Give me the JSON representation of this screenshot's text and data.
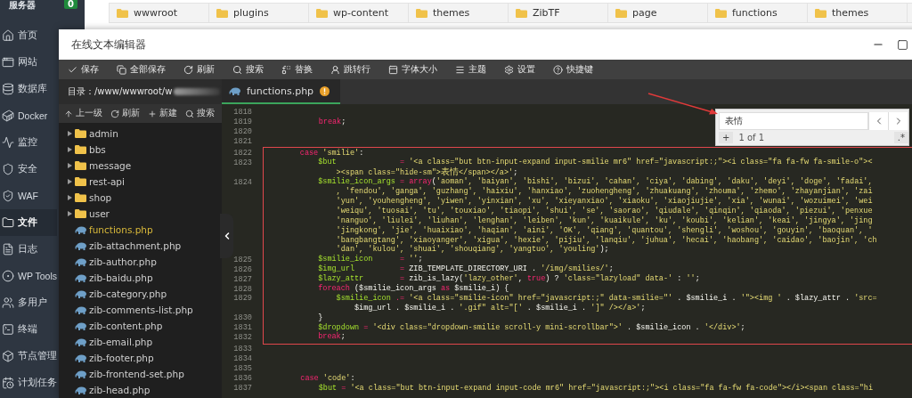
{
  "sidebar": {
    "header": {
      "label": "服务器",
      "badge": "0"
    },
    "items": [
      {
        "label": "首页",
        "selected": false
      },
      {
        "label": "网站",
        "selected": false
      },
      {
        "label": "数据库",
        "selected": false
      },
      {
        "label": "Docker",
        "selected": false
      },
      {
        "label": "监控",
        "selected": false
      },
      {
        "label": "安全",
        "selected": false
      },
      {
        "label": "WAF",
        "selected": false
      },
      {
        "label": "文件",
        "selected": true
      },
      {
        "label": "日志",
        "selected": false
      },
      {
        "label": "WP Tools",
        "selected": false
      },
      {
        "label": "多用户",
        "selected": false
      },
      {
        "label": "终端",
        "selected": false
      },
      {
        "label": "节点管理",
        "selected": false
      },
      {
        "label": "计划任务",
        "selected": false
      }
    ]
  },
  "breadcrumb": [
    "wwwroot",
    "plugins",
    "wp-content",
    "themes",
    "ZibTF",
    "page",
    "functions",
    "themes"
  ],
  "editor_window": {
    "title": "在线文本编辑器",
    "toolbar": [
      "保存",
      "全部保存",
      "刷新",
      "搜索",
      "替换",
      "跳转行",
      "字体大小",
      "主题",
      "设置",
      "快捷键"
    ],
    "directory": {
      "path": "目录：/www/wwwroot/w",
      "actions": [
        "上一级",
        "刷新",
        "新建",
        "搜索"
      ]
    },
    "files": [
      {
        "name": "admin",
        "kind": "folder",
        "selected": false
      },
      {
        "name": "bbs",
        "kind": "folder",
        "selected": false
      },
      {
        "name": "message",
        "kind": "folder",
        "selected": false
      },
      {
        "name": "rest-api",
        "kind": "folder",
        "selected": false
      },
      {
        "name": "shop",
        "kind": "folder",
        "selected": false
      },
      {
        "name": "user",
        "kind": "folder",
        "selected": false
      },
      {
        "name": "functions.php",
        "kind": "file",
        "selected": true
      },
      {
        "name": "zib-attachment.php",
        "kind": "file",
        "selected": false
      },
      {
        "name": "zib-author.php",
        "kind": "file",
        "selected": false
      },
      {
        "name": "zib-baidu.php",
        "kind": "file",
        "selected": false
      },
      {
        "name": "zib-category.php",
        "kind": "file",
        "selected": false
      },
      {
        "name": "zib-comments-list.php",
        "kind": "file",
        "selected": false
      },
      {
        "name": "zib-content.php",
        "kind": "file",
        "selected": false
      },
      {
        "name": "zib-email.php",
        "kind": "file",
        "selected": false
      },
      {
        "name": "zib-footer.php",
        "kind": "file",
        "selected": false
      },
      {
        "name": "zib-frontend-set.php",
        "kind": "file",
        "selected": false
      },
      {
        "name": "zib-head.php",
        "kind": "file",
        "selected": false
      }
    ],
    "tab": {
      "label": "functions.php",
      "unsaved": true
    },
    "search_widget": {
      "query": "表情",
      "add_label": "+",
      "count": "1 of 1",
      "regex_label": ".*"
    },
    "code_blocks": [
      {
        "boxed": false,
        "lines": [
          {
            "num": "1818"
          },
          {
            "num": "1819",
            "rows": [
              {
                "tokens": [
                  {
                    "kind": "keyword",
                    "text": "            break"
                  },
                  {
                    "kind": "plain",
                    "text": ";"
                  }
                ]
              }
            ]
          },
          {
            "num": "1820"
          },
          {
            "num": "1821"
          }
        ]
      },
      {
        "boxed": true,
        "lines": [
          {
            "num": "1822",
            "rows": [
              {
                "tokens": [
                  {
                    "kind": "keyword",
                    "text": "        case "
                  },
                  {
                    "kind": "string",
                    "text": "'smilie'"
                  },
                  {
                    "kind": "plain",
                    "text": ":"
                  }
                ]
              }
            ]
          },
          {
            "num": "1823",
            "rows": [
              {
                "tokens": [
                  {
                    "kind": "variable",
                    "text": "            $but              "
                  },
                  {
                    "kind": "operator",
                    "text": "= "
                  },
                  {
                    "kind": "string",
                    "text": "'<a class=\"but btn-input-expand input-smilie mr6\" href=\"javascript:;\"><i class=\"fa fa-fw fa-smile-o\"><"
                  }
                ]
              },
              {
                "tokens": [
                  {
                    "kind": "string",
                    "text": "                ><span class=\"hide-sm\">"
                  },
                  {
                    "kind": "cjk",
                    "text": "表情"
                  },
                  {
                    "kind": "string",
                    "text": "</span></a>'"
                  },
                  {
                    "kind": "plain",
                    "text": ";"
                  }
                ]
              }
            ]
          },
          {
            "num": "1824",
            "rows": [
              {
                "tokens": [
                  {
                    "kind": "variable",
                    "text": "            $smilie_icon_args "
                  },
                  {
                    "kind": "operator",
                    "text": "= "
                  },
                  {
                    "kind": "keyword",
                    "text": "array"
                  },
                  {
                    "kind": "plain",
                    "text": "("
                  },
                  {
                    "kind": "string",
                    "text": "'aoman', 'baiyan', 'bishi', 'bizui', 'cahan', 'ciya', 'dabing', 'daku', 'deyi', 'doge', 'fadai',"
                  }
                ]
              },
              {
                "tokens": [
                  {
                    "kind": "string",
                    "text": "                , 'fendou', 'ganga', 'guzhang', 'haixiu', 'hanxiao', 'zuohengheng', 'zhuakuang', 'zhouma', 'zhemo', 'zhayanjian', 'zai"
                  }
                ]
              },
              {
                "tokens": [
                  {
                    "kind": "string",
                    "text": "                'yun', 'youhengheng', 'yiwen', 'yinxian', 'xu', 'xieyanxiao', 'xiaoku', 'xiaojiujie', 'xia', 'wunai', 'wozuimei', 'wei"
                  }
                ]
              },
              {
                "tokens": [
                  {
                    "kind": "string",
                    "text": "                'weiqu', 'tuosai', 'tu', 'touxiao', 'tiaopi', 'shui', 'se', 'saorao', 'qiudale', 'qinqin', 'qiaoda', 'piezui', 'penxue"
                  }
                ]
              },
              {
                "tokens": [
                  {
                    "kind": "string",
                    "text": "                'nanguo', 'liulei', 'liuhan', 'lenghan', 'leiben', 'kun', 'kuaikule', 'ku', 'koubi', 'kelian', 'keai', 'jingya', 'jing"
                  }
                ]
              },
              {
                "tokens": [
                  {
                    "kind": "string",
                    "text": "                'jingkong', 'jie', 'huaixiao', 'haqian', 'aini', 'OK', 'qiang', 'quantou', 'shengli', 'woshou', 'gouyin', 'baoquan', '"
                  }
                ]
              },
              {
                "tokens": [
                  {
                    "kind": "string",
                    "text": "                'bangbangtang', 'xiaoyanger', 'xigua', 'hexie', 'pijiu', 'lanqiu', 'juhua', 'hecai', 'haobang', 'caidao', 'baojin', 'ch"
                  }
                ]
              },
              {
                "tokens": [
                  {
                    "kind": "string",
                    "text": "                'dan', 'kulou', 'shuai', 'shouqiang', 'yangtuo', 'youling'"
                  },
                  {
                    "kind": "plain",
                    "text": ");"
                  }
                ]
              }
            ]
          },
          {
            "num": "1825",
            "rows": [
              {
                "tokens": [
                  {
                    "kind": "variable",
                    "text": "            $smilie_icon      "
                  },
                  {
                    "kind": "operator",
                    "text": "= "
                  },
                  {
                    "kind": "string",
                    "text": "''"
                  },
                  {
                    "kind": "plain",
                    "text": ";"
                  }
                ]
              }
            ]
          },
          {
            "num": "1826",
            "rows": [
              {
                "tokens": [
                  {
                    "kind": "variable",
                    "text": "            $img_url          "
                  },
                  {
                    "kind": "operator",
                    "text": "="
                  },
                  {
                    "kind": "plain",
                    "text": " ZIB_TEMPLATE_DIRECTORY_URI . "
                  },
                  {
                    "kind": "string",
                    "text": "'/img/smilies/'"
                  },
                  {
                    "kind": "plain",
                    "text": ";"
                  }
                ]
              }
            ]
          },
          {
            "num": "1827",
            "rows": [
              {
                "tokens": [
                  {
                    "kind": "variable",
                    "text": "            $lazy_attr        "
                  },
                  {
                    "kind": "operator",
                    "text": "="
                  },
                  {
                    "kind": "plain",
                    "text": " zib_is_lazy("
                  },
                  {
                    "kind": "string",
                    "text": "'lazy_other'"
                  },
                  {
                    "kind": "plain",
                    "text": ", "
                  },
                  {
                    "kind": "keyword",
                    "text": "true"
                  },
                  {
                    "kind": "plain",
                    "text": ") ? "
                  },
                  {
                    "kind": "string",
                    "text": "'class=\"lazyload\" data-'"
                  },
                  {
                    "kind": "plain",
                    "text": " : "
                  },
                  {
                    "kind": "string",
                    "text": "''"
                  },
                  {
                    "kind": "plain",
                    "text": ";"
                  }
                ]
              }
            ]
          },
          {
            "num": "1828",
            "rows": [
              {
                "tokens": [
                  {
                    "kind": "keyword",
                    "text": "            foreach"
                  },
                  {
                    "kind": "plain",
                    "text": " ($smilie_icon_args "
                  },
                  {
                    "kind": "keyword",
                    "text": "as"
                  },
                  {
                    "kind": "plain",
                    "text": " $smilie_i) {"
                  }
                ]
              }
            ]
          },
          {
            "num": "1829",
            "rows": [
              {
                "tokens": [
                  {
                    "kind": "variable",
                    "text": "                $smilie_icon "
                  },
                  {
                    "kind": "operator",
                    "text": ".= "
                  },
                  {
                    "kind": "string",
                    "text": "'<a class=\"smilie-icon\" href=\"javascript:;\" data-smilie=\"'"
                  },
                  {
                    "kind": "plain",
                    "text": " . $smilie_i . "
                  },
                  {
                    "kind": "string",
                    "text": "'\"><img '"
                  },
                  {
                    "kind": "plain",
                    "text": " . $lazy_attr . "
                  },
                  {
                    "kind": "string",
                    "text": "'src="
                  }
                ]
              },
              {
                "tokens": [
                  {
                    "kind": "plain",
                    "text": "                    $img_url . $smilie_i . "
                  },
                  {
                    "kind": "string",
                    "text": "'.gif\" alt=\"['"
                  },
                  {
                    "kind": "plain",
                    "text": " . $smilie_i . "
                  },
                  {
                    "kind": "string",
                    "text": "']\" /></a>'"
                  },
                  {
                    "kind": "plain",
                    "text": ";"
                  }
                ]
              }
            ]
          },
          {
            "num": "1830",
            "rows": [
              {
                "tokens": [
                  {
                    "kind": "plain",
                    "text": "            }"
                  }
                ]
              }
            ]
          },
          {
            "num": "1831",
            "rows": [
              {
                "tokens": [
                  {
                    "kind": "variable",
                    "text": "            $dropdown "
                  },
                  {
                    "kind": "operator",
                    "text": "= "
                  },
                  {
                    "kind": "string",
                    "text": "'<div class=\"dropdown-smilie scroll-y mini-scrollbar\">'"
                  },
                  {
                    "kind": "plain",
                    "text": " . $smilie_icon . "
                  },
                  {
                    "kind": "string",
                    "text": "'</div>'"
                  },
                  {
                    "kind": "plain",
                    "text": ";"
                  }
                ]
              }
            ]
          },
          {
            "num": "1832",
            "rows": [
              {
                "tokens": [
                  {
                    "kind": "keyword",
                    "text": "            break"
                  },
                  {
                    "kind": "plain",
                    "text": ";"
                  }
                ]
              }
            ]
          }
        ]
      },
      {
        "boxed": false,
        "lines": [
          {
            "num": "1833"
          },
          {
            "num": "1834"
          },
          {
            "num": "1835"
          },
          {
            "num": "1836",
            "rows": [
              {
                "tokens": [
                  {
                    "kind": "keyword",
                    "text": "        case "
                  },
                  {
                    "kind": "string",
                    "text": "'code'"
                  },
                  {
                    "kind": "plain",
                    "text": ":"
                  }
                ]
              }
            ]
          },
          {
            "num": "1837",
            "rows": [
              {
                "tokens": [
                  {
                    "kind": "variable",
                    "text": "            $but "
                  },
                  {
                    "kind": "operator",
                    "text": "= "
                  },
                  {
                    "kind": "string",
                    "text": "'<a class=\"but btn-input-expand input-code mr6\" href=\"javascript:;\"><i class=\"fa fa-fw fa-code\"></i><span class=\"hi"
                  }
                ]
              }
            ]
          }
        ]
      }
    ]
  }
}
